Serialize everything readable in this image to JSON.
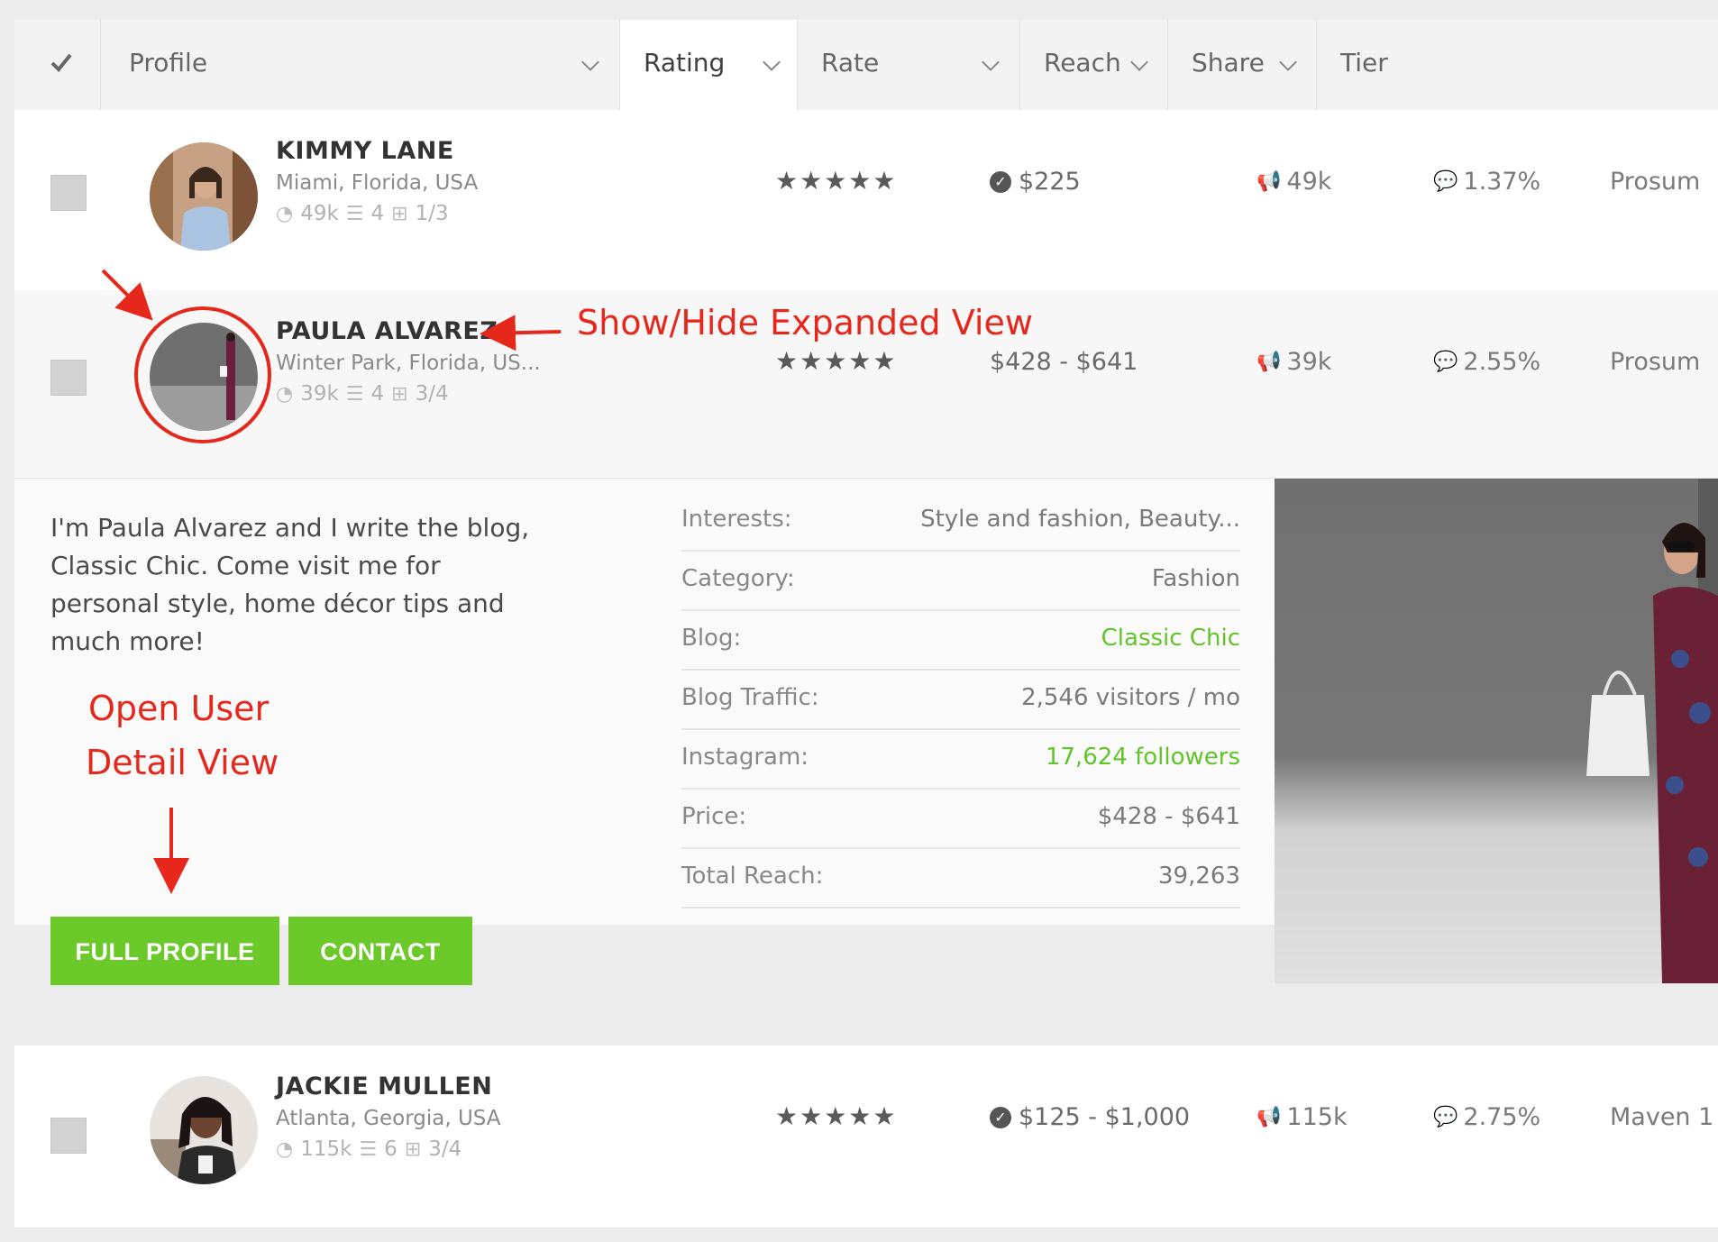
{
  "header": {
    "check_icon": "checkmark-icon",
    "columns": [
      "Profile",
      "Rating",
      "Rate",
      "Reach",
      "Share",
      "Tier"
    ]
  },
  "rows": [
    {
      "name": "KIMMY LANE",
      "location": "Miami, Florida, USA",
      "mini_reach": "49k",
      "mini_lists": "4",
      "mini_campaigns": "1/3",
      "rating": 5,
      "rate": "$225",
      "rate_verified": true,
      "reach": "49k",
      "share": "1.37%",
      "tier": "Prosum"
    },
    {
      "name": "PAULA ALVAREZ",
      "location": "Winter Park, Florida, US...",
      "mini_reach": "39k",
      "mini_lists": "4",
      "mini_campaigns": "3/4",
      "rating": 5,
      "rate": "$428 - $641",
      "rate_verified": false,
      "reach": "39k",
      "share": "2.55%",
      "tier": "Prosum"
    },
    {
      "name": "JACKIE MULLEN",
      "location": "Atlanta, Georgia, USA",
      "mini_reach": "115k",
      "mini_lists": "6",
      "mini_campaigns": "3/4",
      "rating": 5,
      "rate": "$125 - $1,000",
      "rate_verified": true,
      "reach": "115k",
      "share": "2.75%",
      "tier": "Maven 1"
    }
  ],
  "expanded": {
    "bio": "I'm Paula Alvarez and I write the blog, Classic Chic. Come visit me for personal style, home décor tips and much more!",
    "details": [
      {
        "label": "Interests:",
        "value": "Style and fashion, Beauty..."
      },
      {
        "label": "Category:",
        "value": "Fashion"
      },
      {
        "label": "Blog:",
        "value": "Classic Chic"
      },
      {
        "label": "Blog Traffic:",
        "value": "2,546 visitors / mo"
      },
      {
        "label": "Instagram:",
        "value": "17,624 followers"
      },
      {
        "label": "Price:",
        "value": "$428 - $641"
      },
      {
        "label": "Total Reach:",
        "value": "39,263"
      }
    ],
    "buttons": {
      "full_profile": "FULL PROFILE",
      "contact": "CONTACT"
    }
  },
  "annotations": {
    "show_hide": "Show/Hide Expanded View",
    "open_user_line1": "Open User",
    "open_user_line2": "Detail View",
    "color": "#e5271c"
  },
  "colors": {
    "accent_green": "#6cc92a",
    "link_green": "#62c32b",
    "annotation_red": "#e5271c"
  }
}
